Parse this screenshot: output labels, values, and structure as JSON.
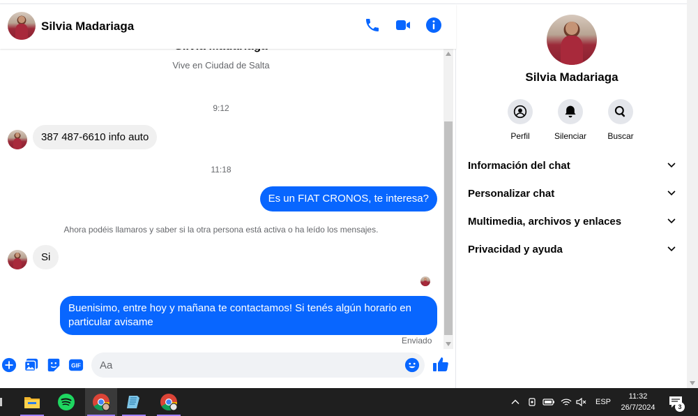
{
  "contact": {
    "name": "Silvia Madariaga",
    "location": "Vive en Ciudad de Salta"
  },
  "messages": {
    "time_1": "9:12",
    "in_1": "387 487-6610 info auto",
    "time_2": "11:18",
    "out_1": "Es un FIAT CRONOS, te interesa?",
    "notice": "Ahora podéis llamaros y saber si la otra persona está activa o ha leído los mensajes.",
    "in_2": "Si",
    "out_2": "Buenisimo, entre hoy y mañana te contactamos! Si tenés algún horario en particular avisame",
    "status": "Enviado"
  },
  "composer": {
    "placeholder": "Aa",
    "gif_label": "GIF"
  },
  "info_panel": {
    "actions": [
      {
        "label": "Perfil",
        "icon": "profile-icon"
      },
      {
        "label": "Silenciar",
        "icon": "bell-icon"
      },
      {
        "label": "Buscar",
        "icon": "search-icon"
      }
    ],
    "sections": [
      {
        "label": "Información del chat"
      },
      {
        "label": "Personalizar chat"
      },
      {
        "label": "Multimedia, archivos y enlaces"
      },
      {
        "label": "Privacidad y ayuda"
      }
    ]
  },
  "taskbar": {
    "language": "ESP",
    "time": "11:32",
    "date": "26/7/2024",
    "notifications": "3"
  },
  "colors": {
    "accent": "#0866ff",
    "incoming_bubble": "#f0f0f0",
    "taskbar": "#1f1f1f"
  }
}
